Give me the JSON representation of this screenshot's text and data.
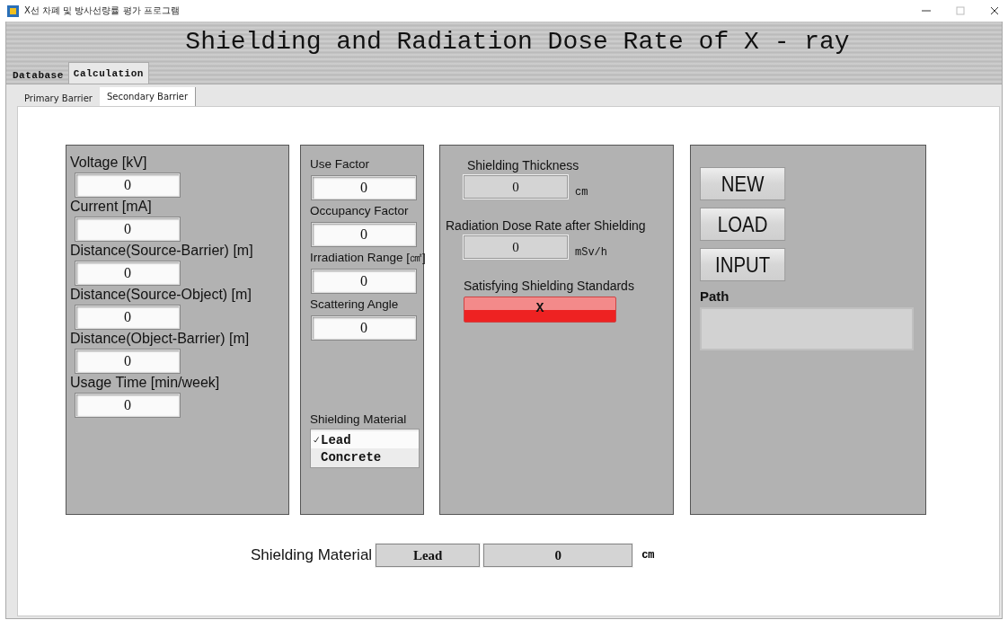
{
  "window": {
    "title": "X선 차폐 및 방사선량률 평가 프로그램"
  },
  "header": {
    "title": "Shielding and Radiation Dose Rate of X - ray"
  },
  "tabs": [
    {
      "label": "Database",
      "selected": false
    },
    {
      "label": "Calculation",
      "selected": true
    }
  ],
  "subtabs": [
    {
      "label": "Primary Barrier",
      "selected": false
    },
    {
      "label": "Secondary Barrier",
      "selected": true
    }
  ],
  "inputs_panel": {
    "fields": [
      {
        "label": "Voltage [kV]",
        "value": "0"
      },
      {
        "label": "Current [mA]",
        "value": "0"
      },
      {
        "label": "Distance(Source-Barrier) [m]",
        "value": "0"
      },
      {
        "label": "Distance(Source-Object) [m]",
        "value": "0"
      },
      {
        "label": "Distance(Object-Barrier) [m]",
        "value": "0"
      },
      {
        "label": "Usage Time [min/week]",
        "value": "0"
      }
    ]
  },
  "factors_panel": {
    "fields": [
      {
        "label": "Use Factor",
        "value": "0"
      },
      {
        "label": "Occupancy Factor",
        "value": "0"
      },
      {
        "label": "Irradiation Range [㎠]",
        "value": "0"
      },
      {
        "label": "Scattering Angle",
        "value": "0"
      }
    ],
    "material": {
      "label": "Shielding Material",
      "options": [
        {
          "label": "Lead",
          "selected": true
        },
        {
          "label": "Concrete",
          "selected": false
        }
      ]
    }
  },
  "results_panel": {
    "outputs": [
      {
        "label": "Shielding Thickness",
        "value": "0",
        "unit": "cm"
      },
      {
        "label": "Radiation Dose Rate after Shielding",
        "value": "0",
        "unit": "mSv/h"
      }
    ],
    "standard": {
      "label": "Satisfying Shielding Standards",
      "value": "X",
      "satisfied": false
    }
  },
  "actions_panel": {
    "buttons": [
      "NEW",
      "LOAD",
      "INPUT"
    ],
    "path": {
      "label": "Path"
    }
  },
  "summary": {
    "label": "Shielding Material",
    "material": "Lead",
    "value": "0",
    "unit": "cm"
  }
}
